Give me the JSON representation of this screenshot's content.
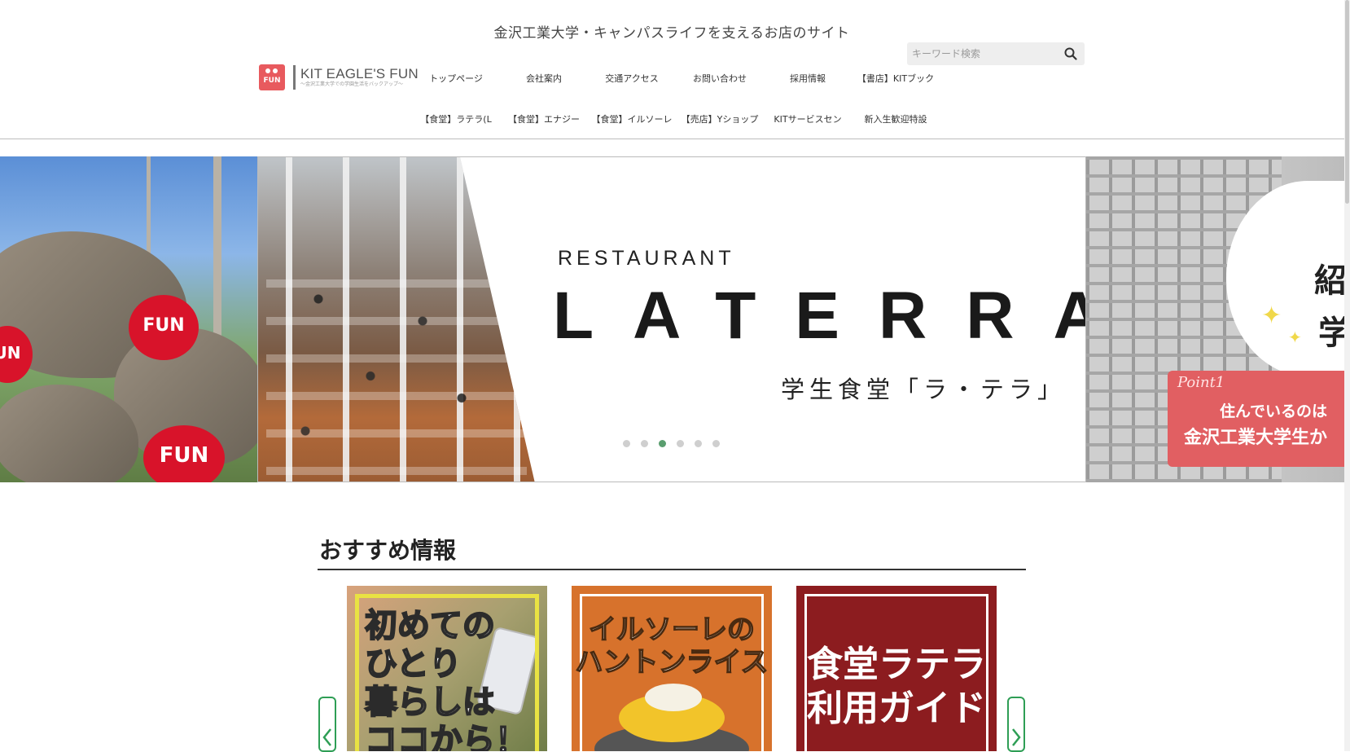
{
  "header": {
    "tagline": "金沢工業大学・キャンパスライフを支えるお店のサイト",
    "logo": {
      "mark_text": "FUN",
      "name": "KIT EAGLE'S FUN",
      "sub": "〜金沢工業大学での学園生活をバックアップ〜"
    },
    "search": {
      "placeholder": "キーワード検索",
      "icon": "search-icon"
    }
  },
  "nav": {
    "row1": [
      "トップページ",
      "会社案内",
      "交通アクセス",
      "お問い合わせ",
      "採用情報",
      "【書店】KITブック"
    ],
    "row2": [
      "【食堂】ラテラ(L",
      "【食堂】エナジー",
      "【食堂】イルソーレ",
      "【売店】Yショップ",
      "KITサービスセン",
      "新入生歓迎特設"
    ]
  },
  "slider": {
    "left": {
      "mascot_label": "FUN",
      "mascot_label_partial": "UN"
    },
    "center": {
      "label": "RESTAURANT",
      "title": "LATERRA",
      "subtitle": "学生食堂「ラ・テラ」"
    },
    "right": {
      "point": "Point1",
      "line1": "住んでいるのは",
      "line2": "金沢工業大学生か",
      "big1": "紹",
      "big2": "学"
    },
    "dots": {
      "count": 6,
      "active_index": 2
    },
    "colors": {
      "active_dot": "#5a9e6f",
      "inactive_dot": "#cfcfcf"
    }
  },
  "recommend": {
    "title": "おすすめ情報",
    "cards": [
      {
        "text": "初めての\nひとり\n暮らしは\nココから！"
      },
      {
        "text": "イルソーレの\nハントンライス"
      },
      {
        "text": "食堂ラテラ\n利用ガイド"
      }
    ],
    "prev_icon": "chevron-left-icon",
    "next_icon": "chevron-right-icon",
    "accent": "#2e9e55"
  }
}
